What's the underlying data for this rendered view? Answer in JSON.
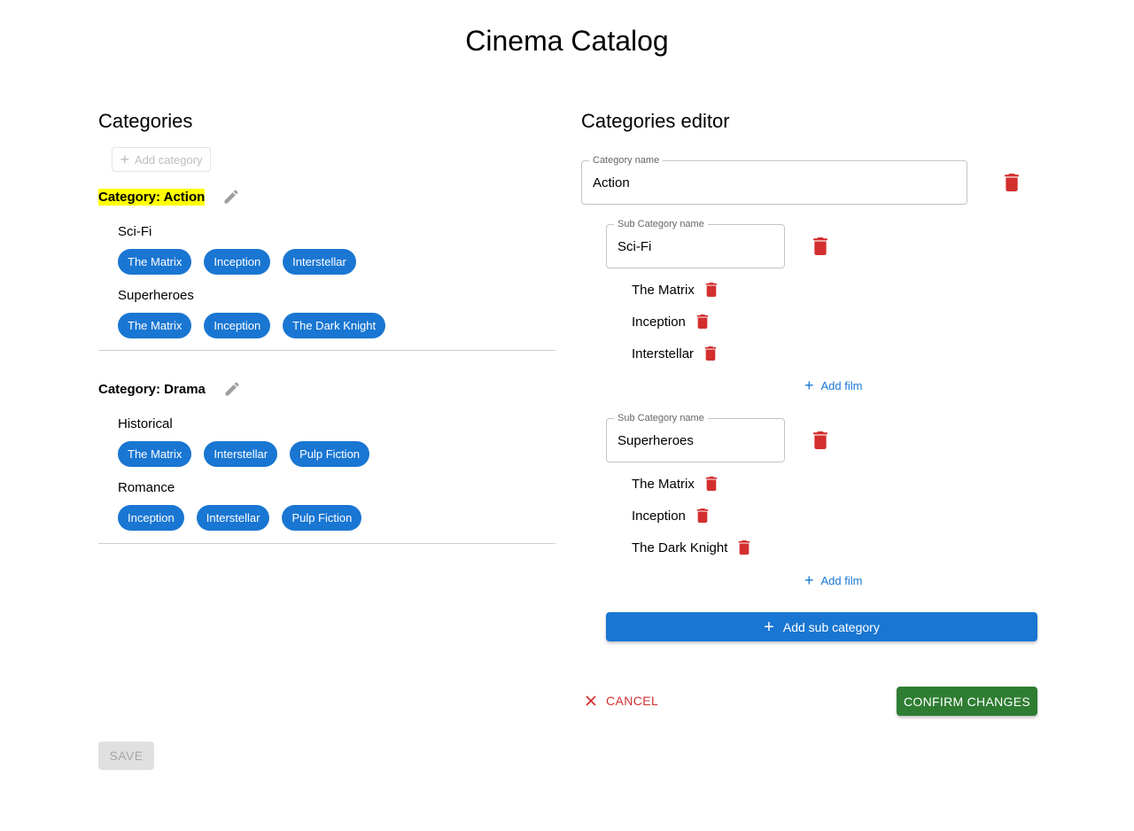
{
  "app": {
    "title": "Cinema Catalog"
  },
  "left": {
    "heading": "Categories",
    "add_category_label": "Add category",
    "categories": [
      {
        "title": "Category: Action",
        "highlighted": true,
        "subs": [
          {
            "name": "Sci-Fi",
            "films": [
              "The Matrix",
              "Inception",
              "Interstellar"
            ]
          },
          {
            "name": "Superheroes",
            "films": [
              "The Matrix",
              "Inception",
              "The Dark Knight"
            ]
          }
        ]
      },
      {
        "title": "Category: Drama",
        "highlighted": false,
        "subs": [
          {
            "name": "Historical",
            "films": [
              "The Matrix",
              "Interstellar",
              "Pulp Fiction"
            ]
          },
          {
            "name": "Romance",
            "films": [
              "Inception",
              "Interstellar",
              "Pulp Fiction"
            ]
          }
        ]
      }
    ],
    "save_label": "SAVE"
  },
  "editor": {
    "heading": "Categories editor",
    "category_label": "Category name",
    "category_value": "Action",
    "sub_label": "Sub Category name",
    "subs": [
      {
        "name": "Sci-Fi",
        "films": [
          "The Matrix",
          "Inception",
          "Interstellar"
        ]
      },
      {
        "name": "Superheroes",
        "films": [
          "The Matrix",
          "Inception",
          "The Dark Knight"
        ]
      }
    ],
    "add_film_label": "Add film",
    "add_sub_label": "Add sub category",
    "cancel_label": "CANCEL",
    "confirm_label": "CONFIRM CHANGES"
  },
  "colors": {
    "primary": "#1976d2",
    "danger": "#d32f2f",
    "success": "#2e7d32",
    "highlight": "#ffff00"
  },
  "icons": {
    "edit": "pencil-icon",
    "delete": "trash-icon",
    "add": "plus-icon",
    "cancel": "close-icon"
  }
}
